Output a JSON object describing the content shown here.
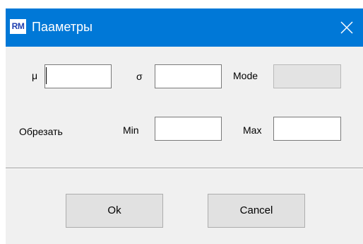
{
  "window": {
    "title": "Пааметры",
    "icon_text": "RM",
    "close_icon": "close-icon",
    "accent": "#0078d7"
  },
  "params": {
    "mu_label": "μ",
    "mu_value": "",
    "sigma_label": "σ",
    "sigma_value": "",
    "mode_label": "Mode",
    "mode_value": ""
  },
  "trim": {
    "label": "Обрезать",
    "min_label": "Min",
    "min_value": "",
    "max_label": "Max",
    "max_value": ""
  },
  "buttons": {
    "ok_label": "Ok",
    "cancel_label": "Cancel"
  }
}
